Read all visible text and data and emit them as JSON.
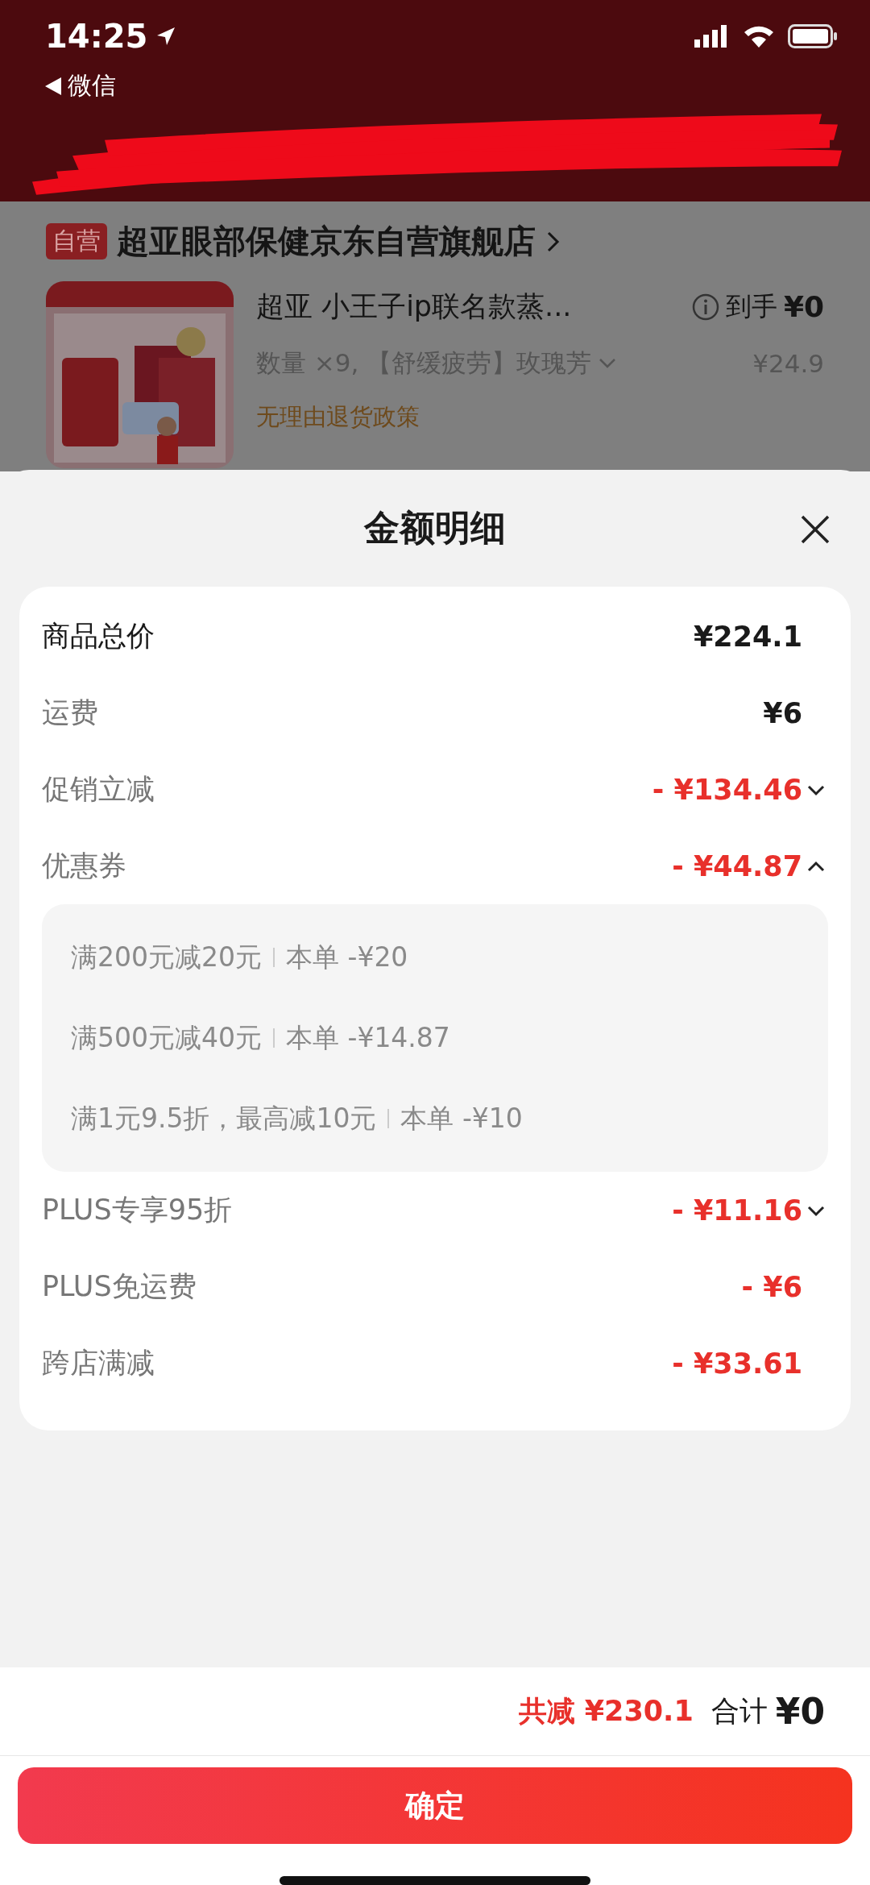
{
  "status_bar": {
    "time": "14:25",
    "back_label": "微信"
  },
  "store": {
    "badge": "自营",
    "name": "超亚眼部保健京东自营旗舰店"
  },
  "product": {
    "title": "超亚 小王子ip联名款蒸...",
    "price_label": "到手",
    "price": "¥0",
    "spec": "数量 ×9, 【舒缓疲劳】玫瑰芳",
    "unit_price": "¥24.9",
    "policy": "无理由退货政策"
  },
  "sheet": {
    "title": "金额明细"
  },
  "rows": [
    {
      "kind": "total",
      "label": "商品总价",
      "value": "¥224.1"
    },
    {
      "kind": "fee",
      "label": "运费",
      "value": "¥6"
    },
    {
      "kind": "discount",
      "label": "促销立减",
      "value": "- ¥134.46",
      "expanded": false
    },
    {
      "kind": "discount",
      "label": "优惠券",
      "value": "- ¥44.87",
      "expanded": true,
      "details": [
        {
          "rule": "满200元减20元",
          "amount": "本单 -¥20"
        },
        {
          "rule": "满500元减40元",
          "amount": "本单 -¥14.87"
        },
        {
          "rule": "满1元9.5折，最高减10元",
          "amount": "本单 -¥10"
        }
      ]
    },
    {
      "kind": "discount",
      "label": "PLUS专享95折",
      "value": "- ¥11.16",
      "expanded": false
    },
    {
      "kind": "discount",
      "label": "PLUS免运费",
      "value": "- ¥6"
    },
    {
      "kind": "discount",
      "label": "跨店满减",
      "value": "- ¥33.61"
    }
  ],
  "footer": {
    "saved": "共减 ¥230.1",
    "total_label": "合计",
    "total": "¥0",
    "confirm": "确定"
  }
}
